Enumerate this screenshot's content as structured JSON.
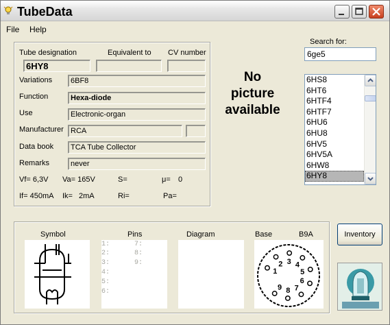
{
  "window": {
    "title": "TubeData"
  },
  "menu": {
    "file": "File",
    "help": "Help"
  },
  "tube": {
    "designation_label": "Tube designation",
    "equivalent_label": "Equivalent to",
    "cv_label": "CV number",
    "designation": "6HY8",
    "equivalent": "",
    "cv_number": "",
    "variations_label": "Variations",
    "variations": "6BF8",
    "function_label": "Function",
    "function": "Hexa-diode",
    "use_label": "Use",
    "use": "Electronic-organ",
    "manufacturer_label": "Manufacturer",
    "manufacturer": "RCA",
    "manufacturer_extra": "",
    "databook_label": "Data book",
    "databook": "TCA Tube Collector",
    "remarks_label": "Remarks",
    "remarks": "never",
    "vf": "Vf= 6,3V",
    "va": "Va= 165V",
    "s": "S=",
    "mu": "μ=",
    "mu_value": "0",
    "if": "If= 450mA",
    "ik": "Ik=",
    "ik_value": "2mA",
    "ri": "Ri=",
    "pa": "Pa="
  },
  "picture": {
    "line1": "No",
    "line2": "picture",
    "line3": "available"
  },
  "search": {
    "label": "Search for:",
    "value": "6ge5"
  },
  "tube_list": {
    "items": [
      "6HS8",
      "6HT6",
      "6HTF4",
      "6HTF7",
      "6HU6",
      "6HU8",
      "6HV5",
      "6HV5A",
      "6HW8",
      "6HY8"
    ],
    "selected": "6HY8"
  },
  "bottom": {
    "symbol_label": "Symbol",
    "pins_label": "Pins",
    "diagram_label": "Diagram",
    "base_label": "Base",
    "base_type": "B9A",
    "pins_left": [
      "1:",
      "2:",
      "3:",
      "4:",
      "5:",
      "6:"
    ],
    "pins_right": [
      "7:",
      "8:",
      "9:"
    ],
    "base_pins": [
      "1",
      "2",
      "3",
      "4",
      "5",
      "6",
      "7",
      "8",
      "9"
    ]
  },
  "inventory_button": "Inventory",
  "colors": {
    "window_bg": "#ECE9D8",
    "field_border": "#8d8d86",
    "list_selected": "#b6b6b6"
  }
}
